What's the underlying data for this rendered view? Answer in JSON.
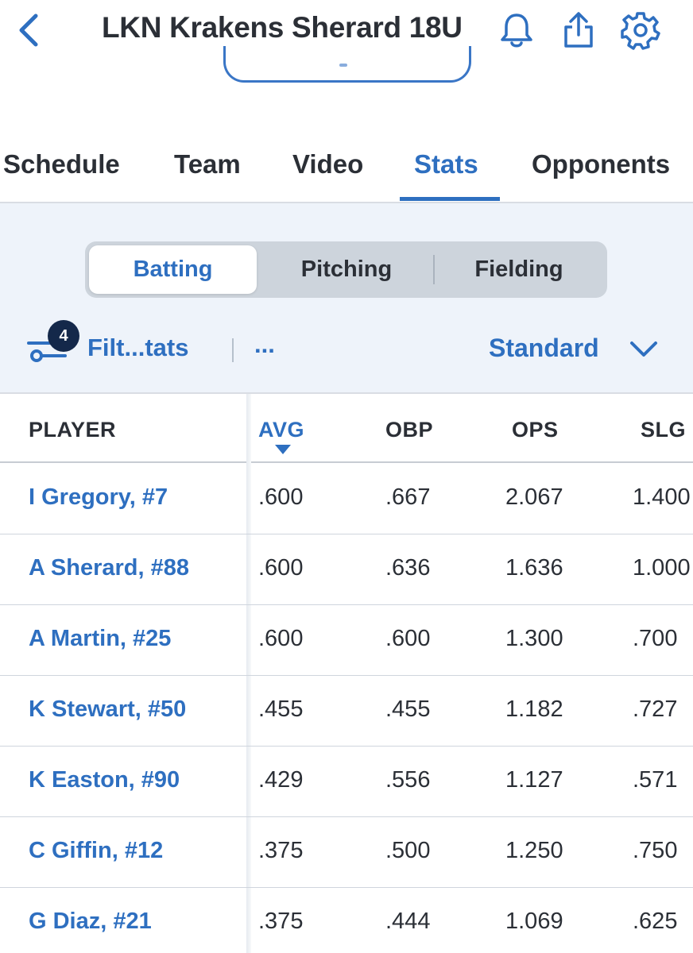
{
  "header": {
    "title": "LKN Krakens Sherard 18U",
    "icons": [
      "back-chevron-icon",
      "bell-icon",
      "share-icon",
      "gear-icon"
    ]
  },
  "tabs": [
    {
      "label": "Schedule",
      "active": false
    },
    {
      "label": "Team",
      "active": false
    },
    {
      "label": "Video",
      "active": false
    },
    {
      "label": "Stats",
      "active": true
    },
    {
      "label": "Opponents",
      "active": false
    }
  ],
  "stat_types": [
    {
      "label": "Batting",
      "active": true
    },
    {
      "label": "Pitching",
      "active": false
    },
    {
      "label": "Fielding",
      "active": false
    }
  ],
  "toolbar": {
    "filter_count": "4",
    "filter_label": "Filt...tats",
    "more_label": "...",
    "view_label": "Standard"
  },
  "table": {
    "columns": [
      "PLAYER",
      "AVG",
      "OBP",
      "OPS",
      "SLG"
    ],
    "sorted_by": "AVG",
    "rows": [
      {
        "player": "I Gregory, #7",
        "avg": ".600",
        "obp": ".667",
        "ops": "2.067",
        "slg": "1.400"
      },
      {
        "player": "A Sherard, #88",
        "avg": ".600",
        "obp": ".636",
        "ops": "1.636",
        "slg": "1.000"
      },
      {
        "player": "A Martin, #25",
        "avg": ".600",
        "obp": ".600",
        "ops": "1.300",
        "slg": ".700"
      },
      {
        "player": "K Stewart, #50",
        "avg": ".455",
        "obp": ".455",
        "ops": "1.182",
        "slg": ".727"
      },
      {
        "player": "K Easton, #90",
        "avg": ".429",
        "obp": ".556",
        "ops": "1.127",
        "slg": ".571"
      },
      {
        "player": "C Giffin, #12",
        "avg": ".375",
        "obp": ".500",
        "ops": "1.250",
        "slg": ".750"
      },
      {
        "player": "G Diaz, #21",
        "avg": ".375",
        "obp": ".444",
        "ops": "1.069",
        "slg": ".625"
      }
    ]
  },
  "colors": {
    "accent": "#2e6fc0",
    "text": "#2b2f36",
    "toolbar_bg": "#eef3fa",
    "badge": "#14284a"
  }
}
